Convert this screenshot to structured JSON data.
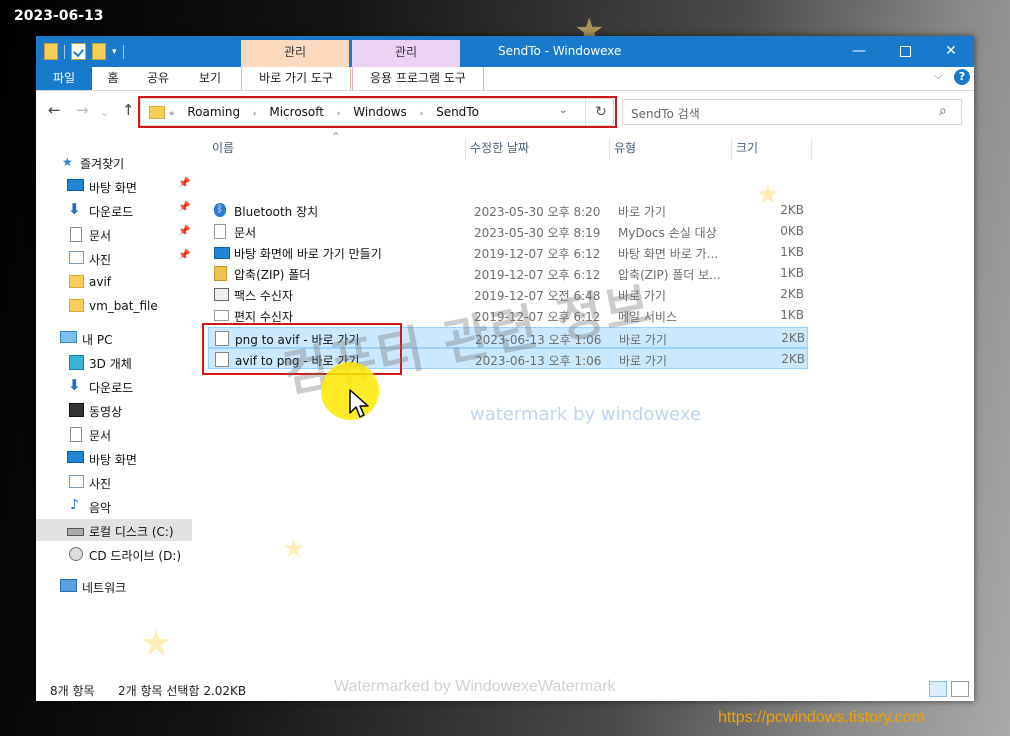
{
  "date_stamp": "2023-06-13",
  "site_url": "https://pcwindows.tistory.com",
  "titlebar": {
    "ctx_tab_1": "관리",
    "ctx_tab_2": "관리",
    "title": "SendTo   - Windowexe",
    "minimize": "—",
    "close": "✕"
  },
  "ribbon": {
    "tabs": [
      "파일",
      "홈",
      "공유",
      "보기",
      "바로 가기 도구",
      "응용 프로그램 도구"
    ],
    "collapse": "⌵",
    "help": "?"
  },
  "nav": {
    "back": "←",
    "forward": "→",
    "up": "↑",
    "recent": "⌄",
    "address": {
      "overflow": "«",
      "crumbs": [
        "Roaming",
        "Microsoft",
        "Windows",
        "SendTo"
      ],
      "separator": "›",
      "dropdown": "⌄",
      "refresh": "↻"
    },
    "search_placeholder": "SendTo 검색",
    "search_icon": "⌕"
  },
  "sidebar": {
    "pin_glyph": "📌",
    "quick_access": "즐겨찾기",
    "quick_items": [
      "바탕 화면",
      "다운로드",
      "문서",
      "사진",
      "avif",
      "vm_bat_file"
    ],
    "this_pc": "내 PC",
    "pc_items": [
      "3D 개체",
      "다운로드",
      "동영상",
      "문서",
      "바탕 화면",
      "사진",
      "음악",
      "로컬 디스크 (C:)",
      "CD 드라이브 (D:)"
    ],
    "network": "네트워크"
  },
  "columns": {
    "name": "이름",
    "date": "수정한 날짜",
    "type": "유형",
    "size": "크기",
    "sort_indicator": "^"
  },
  "files": [
    {
      "name": "Bluetooth 장치",
      "date": "2023-05-30 오후 8:20",
      "type": "바로 가기",
      "size": "2KB",
      "icon": "bluetooth-icon",
      "selected": false
    },
    {
      "name": "문서",
      "date": "2023-05-30 오후 8:19",
      "type": "MyDocs 손실 대상",
      "size": "0KB",
      "icon": "document-icon",
      "selected": false
    },
    {
      "name": "바탕 화면에 바로 가기 만들기",
      "date": "2019-12-07 오후 6:12",
      "type": "바탕 화면 바로 가...",
      "size": "1KB",
      "icon": "desktop-icon",
      "selected": false
    },
    {
      "name": "압축(ZIP) 폴더",
      "date": "2019-12-07 오후 6:12",
      "type": "압축(ZIP) 폴더 보...",
      "size": "1KB",
      "icon": "zip-folder-icon",
      "selected": false
    },
    {
      "name": "팩스 수신자",
      "date": "2019-12-07 오전 6:48",
      "type": "바로 가기",
      "size": "2KB",
      "icon": "fax-icon",
      "selected": false
    },
    {
      "name": "편지 수신자",
      "date": "2019-12-07 오후 6:12",
      "type": "메일 서비스",
      "size": "1KB",
      "icon": "mail-icon",
      "selected": false
    },
    {
      "name": "png to avif - 바로 가기",
      "date": "2023-06-13 오후 1:06",
      "type": "바로 가기",
      "size": "2KB",
      "icon": "shortcut-icon",
      "selected": true
    },
    {
      "name": "avif to png - 바로 가기",
      "date": "2023-06-13 오후 1:06",
      "type": "바로 가기",
      "size": "2KB",
      "icon": "shortcut-icon",
      "selected": true
    }
  ],
  "watermarks": {
    "korean": "컴퓨터 관련 정보",
    "blue": "watermark by windowexe",
    "bottom": "Watermarked by WindowexeWatermark"
  },
  "status": {
    "item_count": "8개 항목",
    "selection": "2개 항목 선택함 2.02KB"
  },
  "colors": {
    "accent": "#1979ca",
    "ctx_manage_1": "#fcd9bf",
    "ctx_manage_2": "#ecd3f3",
    "selection": "#cce8ff",
    "highlight_box": "#d01818",
    "url": "#f2a100"
  }
}
